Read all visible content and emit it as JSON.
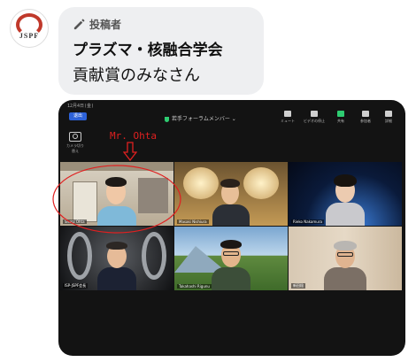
{
  "post": {
    "avatar_text": "JSPF",
    "poster_label": "投稿者",
    "author_name": "プラズマ・核融合学会",
    "message": "貢献賞のみなさん"
  },
  "screenshot": {
    "status_time": "12月4日(金)",
    "end_button": "退出",
    "meeting_title": "若手フォーラムメンバー ⌄",
    "toolbar": [
      {
        "label": "ミュート"
      },
      {
        "label": "ビデオの停止"
      },
      {
        "label": "共有"
      },
      {
        "label": "参加者"
      },
      {
        "label": "詳細"
      }
    ],
    "camera_label": "カメラ切り替え",
    "participants": [
      "Shota Ohta",
      "Masaki Nishiura",
      "Rieko Nakamura",
      "ISP-JSPF会長",
      "Takahashi Rigunu",
      "新田稔"
    ]
  },
  "annotation": {
    "label": "Mr. Ohta",
    "color": "#e02020"
  }
}
